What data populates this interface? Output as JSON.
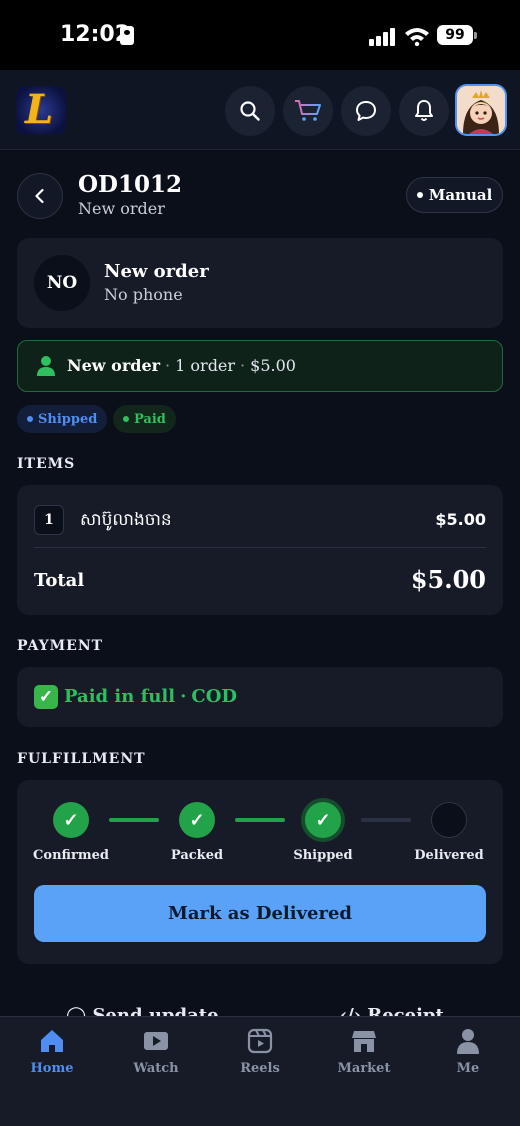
{
  "status_bar": {
    "time": "12:02",
    "battery": "99"
  },
  "header": {
    "logo_letter": "L",
    "icons": [
      "search-icon",
      "cart-icon",
      "chat-icon",
      "bell-icon"
    ]
  },
  "order": {
    "id": "OD1012",
    "subtitle": "New order",
    "source_label": "Manual"
  },
  "customer": {
    "initials": "NO",
    "name": "New order",
    "phone": "No phone"
  },
  "summary": {
    "name": "New order",
    "orders": "1 order",
    "amount": "$5.00"
  },
  "badges": {
    "shipped": "Shipped",
    "paid": "Paid"
  },
  "items_section": {
    "title": "ITEMS",
    "items": [
      {
        "qty": "1",
        "name": "សាប៊ូលាងចាន",
        "price": "$5.00"
      }
    ],
    "total_label": "Total",
    "total_value": "$5.00"
  },
  "payment": {
    "title": "PAYMENT",
    "status": "Paid in full",
    "method": "COD"
  },
  "fulfillment": {
    "title": "FULFILLMENT",
    "steps": [
      {
        "label": "Confirmed",
        "state": "done"
      },
      {
        "label": "Packed",
        "state": "done"
      },
      {
        "label": "Shipped",
        "state": "current"
      },
      {
        "label": "Delivered",
        "state": "pending"
      }
    ],
    "action_label": "Mark as Delivered"
  },
  "more_actions": {
    "send_update": "Send update",
    "receipt": "Receipt"
  },
  "bottom_nav": [
    {
      "label": "Home",
      "icon": "home-icon",
      "active": true
    },
    {
      "label": "Watch",
      "icon": "play-icon",
      "active": false
    },
    {
      "label": "Reels",
      "icon": "reels-icon",
      "active": false
    },
    {
      "label": "Market",
      "icon": "store-icon",
      "active": false
    },
    {
      "label": "Me",
      "icon": "person-icon",
      "active": false
    }
  ],
  "colors": {
    "background": "#0b0f19",
    "card": "#161b27",
    "accent_blue": "#5aa2f7",
    "success_green": "#22a34a",
    "shipped_blue": "#4f8df0"
  }
}
